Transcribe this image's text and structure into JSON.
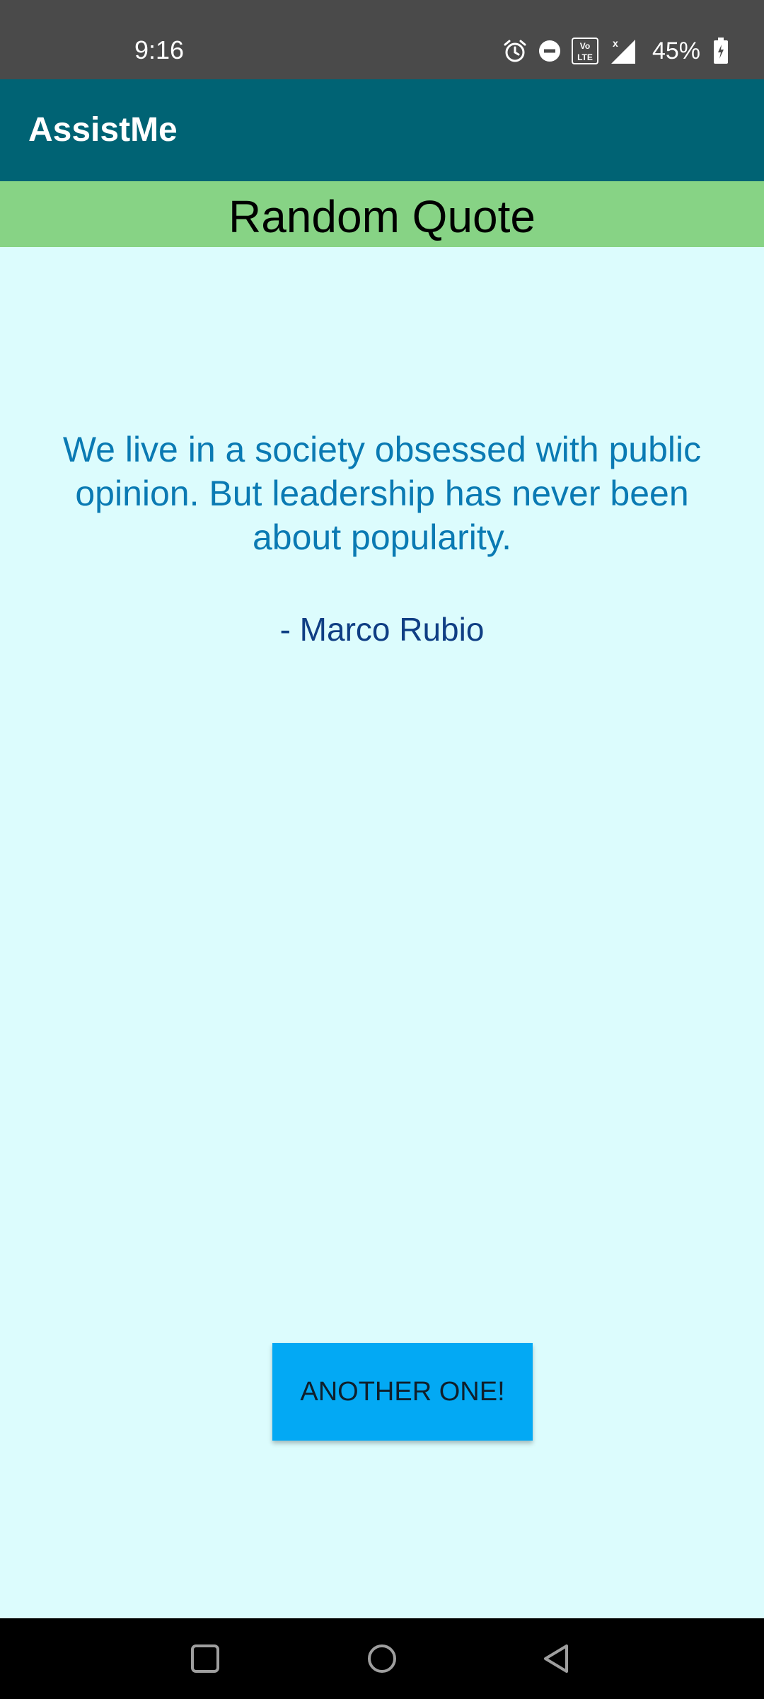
{
  "status_bar": {
    "time": "9:16",
    "battery_percent": "45%",
    "icons": [
      "alarm-icon",
      "do-not-disturb-icon",
      "volte-icon",
      "signal-icon",
      "battery-icon"
    ]
  },
  "app_bar": {
    "title": "AssistMe",
    "color": "#006374"
  },
  "header": {
    "title": "Random Quote",
    "color": "#87d385"
  },
  "quote": {
    "text": "We live in a society obsessed with public opinion. But leadership has never been about popularity.",
    "author": "- Marco Rubio",
    "text_color": "#0a7ab3",
    "author_color": "#0f3e84"
  },
  "actions": {
    "another_label": "ANOTHER ONE!",
    "button_color": "#03a9f4"
  },
  "nav_bar": {
    "icons": [
      "recents-icon",
      "home-icon",
      "back-icon"
    ]
  }
}
